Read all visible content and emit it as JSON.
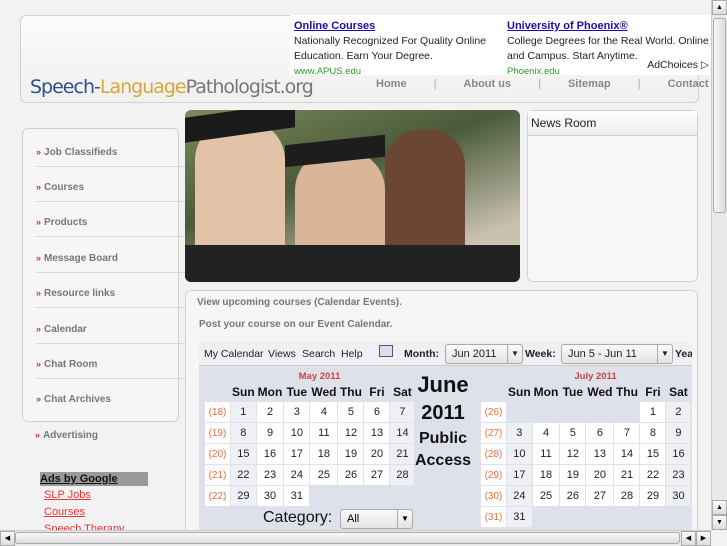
{
  "ads": [
    {
      "title": "Online Courses",
      "text": "Nationally Recognized For Quality Online Education. Earn Your Degree.",
      "url": "www.APUS.edu"
    },
    {
      "title": "University of Phoenix®",
      "text": "College Degrees for the Real World. Online and Campus. Start Anytime.",
      "url": "Phoenix.edu"
    }
  ],
  "adchoices": "AdChoices",
  "logo": {
    "part1": "Speech-",
    "part2": "Language",
    "part3": "Pathologist.org"
  },
  "nav": [
    "Home",
    "About us",
    "Sitemap",
    "Contact Us"
  ],
  "sidebar": [
    "Job Classifieds",
    "Courses",
    "Products",
    "Message Board",
    "Resource links",
    "Calendar",
    "Chat Room",
    "Chat Archives"
  ],
  "advertising": "Advertising",
  "google_ads": {
    "title": "Ads by Google",
    "links": [
      "SLP Jobs",
      "Courses",
      "Speech Therapy"
    ]
  },
  "news_room": "News Room",
  "main": {
    "line1": "View upcoming courses (Calendar Events).",
    "line2": "Post your course on our Event Calendar."
  },
  "toolbar": {
    "menu": [
      "My Calendar",
      "Views",
      "Search",
      "Help"
    ],
    "month_label": "Month:",
    "month_value": "Jun 2011",
    "week_label": "Week:",
    "week_value": "Jun 5 - Jun 11",
    "year_label": "Yea"
  },
  "days": [
    "Sun",
    "Mon",
    "Tue",
    "Wed",
    "Thu",
    "Fri",
    "Sat"
  ],
  "may": {
    "title": "May 2011",
    "weeks": [
      [
        "(18)",
        "1",
        "2",
        "3",
        "4",
        "5",
        "6",
        "7"
      ],
      [
        "(19)",
        "8",
        "9",
        "10",
        "11",
        "12",
        "13",
        "14"
      ],
      [
        "(20)",
        "15",
        "16",
        "17",
        "18",
        "19",
        "20",
        "21"
      ],
      [
        "(21)",
        "22",
        "23",
        "24",
        "25",
        "26",
        "27",
        "28"
      ],
      [
        "(22)",
        "29",
        "30",
        "31",
        "",
        "",
        "",
        ""
      ]
    ]
  },
  "july": {
    "title": "July 2011",
    "weeks": [
      [
        "(26)",
        "",
        "",
        "",
        "",
        "",
        "1",
        "2"
      ],
      [
        "(27)",
        "3",
        "4",
        "5",
        "6",
        "7",
        "8",
        "9"
      ],
      [
        "(28)",
        "10",
        "11",
        "12",
        "13",
        "14",
        "15",
        "16"
      ],
      [
        "(29)",
        "17",
        "18",
        "19",
        "20",
        "21",
        "22",
        "23"
      ],
      [
        "(30)",
        "24",
        "25",
        "26",
        "27",
        "28",
        "29",
        "30"
      ],
      [
        "(31)",
        "31",
        "",
        "",
        "",
        "",
        "",
        ""
      ]
    ]
  },
  "center": {
    "month": "June",
    "year": "2011",
    "line1": "Public",
    "line2": "Access"
  },
  "category": {
    "label": "Category:",
    "value": "All"
  }
}
